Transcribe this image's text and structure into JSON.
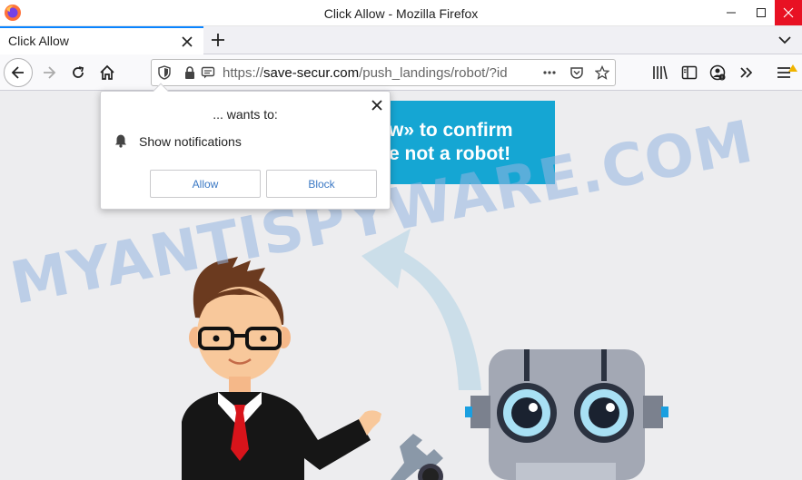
{
  "window": {
    "title": "Click Allow - Mozilla Firefox"
  },
  "tabs": [
    {
      "label": "Click Allow",
      "active": true
    }
  ],
  "urlbar": {
    "scheme": "https://",
    "host": "save-secur.com",
    "path": "/push_landings/robot/?id"
  },
  "page": {
    "cta_line1": "w» to confirm",
    "cta_line2": "e not a robot!",
    "watermark": "MYANTISPYWARE.COM"
  },
  "popup": {
    "heading": "... wants to:",
    "permission": "Show notifications",
    "allow_label": "Allow",
    "block_label": "Block"
  },
  "colors": {
    "accent": "#0a84ff",
    "cta_background": "#15a6d3",
    "close_button": "#e81123",
    "watermark": "#94b4e0"
  },
  "icons": [
    "firefox-logo",
    "minimize-icon",
    "maximize-icon",
    "close-icon",
    "plus-icon",
    "chevron-down-icon",
    "back-arrow-icon",
    "forward-arrow-icon",
    "reload-icon",
    "home-icon",
    "shield-icon",
    "lock-icon",
    "notification-permission-icon",
    "page-actions-icon",
    "pocket-icon",
    "star-icon",
    "library-icon",
    "sidebar-icon",
    "account-icon",
    "overflow-icon",
    "menu-icon",
    "bell-icon"
  ]
}
